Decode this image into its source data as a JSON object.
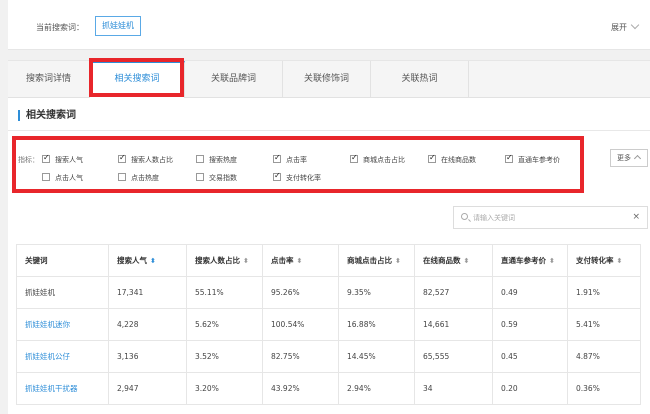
{
  "current_search": {
    "label": "当前搜索词：",
    "tag": "抓娃娃机",
    "expand_label": "展开"
  },
  "tabs": [
    {
      "label": "搜索词详情",
      "active": false
    },
    {
      "label": "相关搜索词",
      "active": true
    },
    {
      "label": "关联品牌词",
      "active": false
    },
    {
      "label": "关联修饰词",
      "active": false
    },
    {
      "label": "关联热词",
      "active": false
    }
  ],
  "section_title": "相关搜索词",
  "indicators": {
    "label": "指标：",
    "items": [
      {
        "label": "搜索人气",
        "checked": true
      },
      {
        "label": "搜索人数占比",
        "checked": true
      },
      {
        "label": "搜索热度",
        "checked": false
      },
      {
        "label": "点击率",
        "checked": true
      },
      {
        "label": "商城点击占比",
        "checked": true
      },
      {
        "label": "在线商品数",
        "checked": true
      },
      {
        "label": "直通车参考价",
        "checked": true
      },
      {
        "label": "点击人气",
        "checked": false
      },
      {
        "label": "点击热度",
        "checked": false
      },
      {
        "label": "交易指数",
        "checked": false
      },
      {
        "label": "支付转化率",
        "checked": true
      }
    ],
    "more_label": "更多"
  },
  "search": {
    "placeholder": "请输入关键词",
    "value": "",
    "clear": "×"
  },
  "table": {
    "columns": [
      {
        "label": "关键词",
        "sort": ""
      },
      {
        "label": "搜索人气",
        "sort": "⬍"
      },
      {
        "label": "搜索人数占比",
        "sort": "⬍"
      },
      {
        "label": "点击率",
        "sort": "⬍"
      },
      {
        "label": "商城点击占比",
        "sort": "⬍"
      },
      {
        "label": "在线商品数",
        "sort": "⬍"
      },
      {
        "label": "直通车参考价",
        "sort": "⬍"
      },
      {
        "label": "支付转化率",
        "sort": "⬍"
      }
    ],
    "rows": [
      [
        "抓娃娃机",
        "17,341",
        "55.11%",
        "95.26%",
        "9.35%",
        "82,527",
        "0.49",
        "1.91%"
      ],
      [
        "抓娃娃机迷你",
        "4,228",
        "5.62%",
        "100.54%",
        "16.88%",
        "14,661",
        "0.59",
        "5.41%"
      ],
      [
        "抓娃娃机公仔",
        "3,136",
        "3.52%",
        "82.75%",
        "14.45%",
        "65,555",
        "0.45",
        "4.87%"
      ],
      [
        "抓娃娃机干扰器",
        "2,947",
        "3.20%",
        "43.92%",
        "2.94%",
        "34",
        "0.20",
        "0.36%"
      ]
    ]
  },
  "colors": {
    "accent": "#2e8ed8",
    "highlight": "#e8262b"
  }
}
